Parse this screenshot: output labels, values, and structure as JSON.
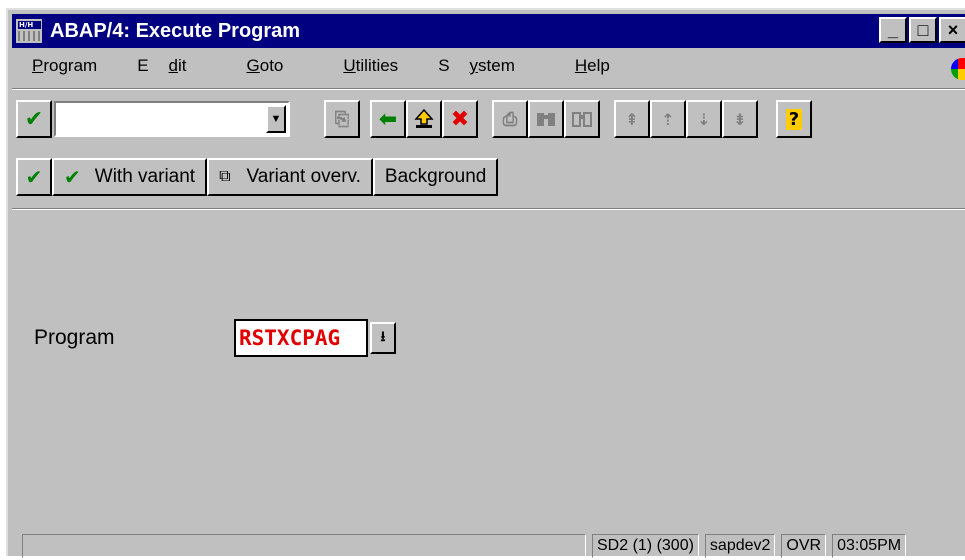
{
  "window": {
    "title": "ABAP/4: Execute Program",
    "icon_text": "H/H",
    "buttons": {
      "minimize": "_",
      "maximize": "□",
      "close": "×"
    }
  },
  "menubar": [
    {
      "pre": "",
      "u": "P",
      "post": "rogram"
    },
    {
      "pre": "E",
      "u": "d",
      "post": "it"
    },
    {
      "pre": "",
      "u": "G",
      "post": "oto"
    },
    {
      "pre": "",
      "u": "U",
      "post": "tilities"
    },
    {
      "pre": "S",
      "u": "y",
      "post": "stem"
    },
    {
      "pre": "",
      "u": "H",
      "post": "elp"
    }
  ],
  "standard_toolbar": {
    "command_field_value": "",
    "icons": [
      "enter-icon",
      "save-icon",
      "back-icon",
      "exit-icon",
      "cancel-icon",
      "print-icon",
      "find-icon",
      "find-next-icon",
      "first-page-icon",
      "previous-page-icon",
      "next-page-icon",
      "last-page-icon",
      "help-icon"
    ]
  },
  "application_toolbar": {
    "with_variant": "With variant",
    "variant_overview": "Variant overv.",
    "background": "Background"
  },
  "form": {
    "program_label": "Program",
    "program_value": "RSTXCPAG"
  },
  "statusbar": {
    "system": "SD2 (1) (300)",
    "server": "sapdev2",
    "mode": "OVR",
    "time": "03:05PM"
  },
  "colors": {
    "titlebar": "#000080",
    "face": "#c0c0c0",
    "enter_check": "#008000",
    "cancel_x": "#e00000",
    "program_value": "#e00000"
  }
}
